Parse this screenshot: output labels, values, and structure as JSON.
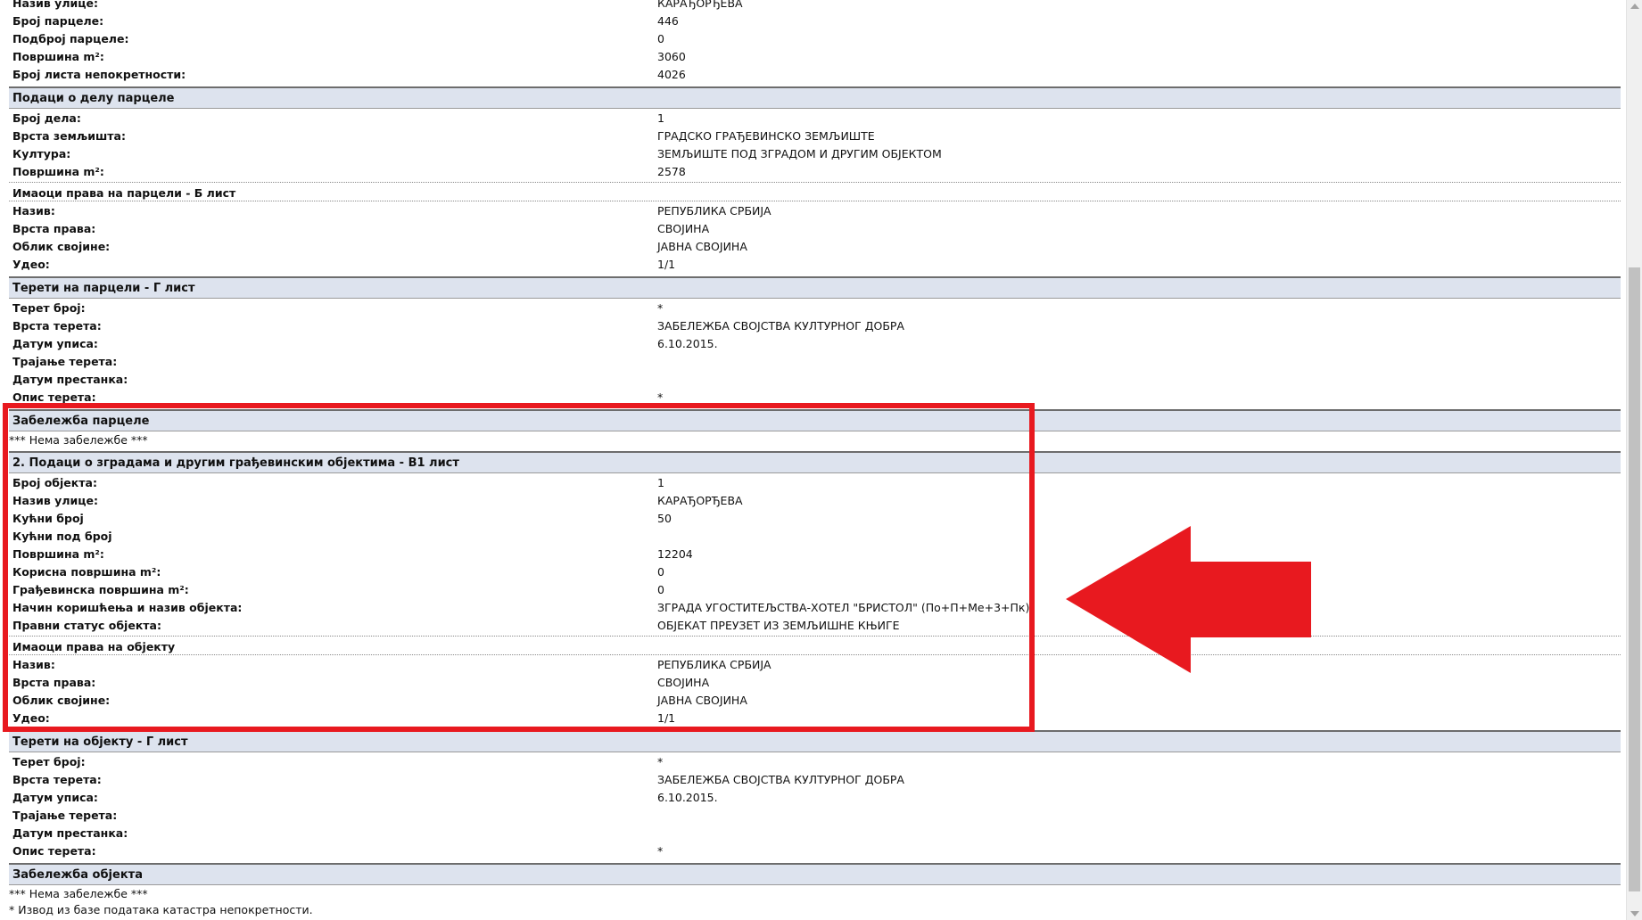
{
  "colors": {
    "section_bg": "#dde3ee",
    "highlight": "#e8191f"
  },
  "parcel_basic": [
    {
      "label": "Назив улице:",
      "value": "КАРАЂОРЂЕВА"
    },
    {
      "label": "Број парцеле:",
      "value": "446"
    },
    {
      "label": "Подброј парцеле:",
      "value": "0"
    },
    {
      "label": "Површина m²:",
      "value": "3060"
    },
    {
      "label": "Број листа непокретности:",
      "value": "4026"
    }
  ],
  "part_section": {
    "title": "Подаци о делу парцеле",
    "rows": [
      {
        "label": "Број дела:",
        "value": "1"
      },
      {
        "label": "Врста земљишта:",
        "value": "ГРАДСКО ГРАЂЕВИНСКО ЗЕМЉИШТЕ"
      },
      {
        "label": "Култура:",
        "value": "ЗЕМЉИШТЕ ПОД ЗГРАДОМ И ДРУГИМ ОБЈЕКТОМ"
      },
      {
        "label": "Површина m²:",
        "value": "2578"
      }
    ],
    "owners_title": "Имаоци права на парцели - Б лист",
    "owners": [
      {
        "label": "Назив:",
        "value": "РЕПУБЛИКА СРБИЈА"
      },
      {
        "label": "Врста права:",
        "value": "СВОЈИНА"
      },
      {
        "label": "Облик својине:",
        "value": "ЈАВНА СВОЈИНА"
      },
      {
        "label": "Удео:",
        "value": "1/1"
      }
    ]
  },
  "parcel_burdens": {
    "title": "Терети на парцели - Г лист",
    "rows": [
      {
        "label": "Терет број:",
        "value": "*"
      },
      {
        "label": "Врста терета:",
        "value": "ЗАБЕЛЕЖБА СВОЈСТВА КУЛТУРНОГ ДОБРА"
      },
      {
        "label": "Датум уписа:",
        "value": "6.10.2015."
      },
      {
        "label": "Трајање терета:",
        "value": ""
      },
      {
        "label": "Датум престанка:",
        "value": ""
      },
      {
        "label": "Опис терета:",
        "value": "*"
      }
    ]
  },
  "parcel_note": {
    "title": "Забележба парцеле",
    "text": "*** Нема забележбе ***"
  },
  "buildings": {
    "title": "2. Подаци о зградама и другим грађевинским објектима - В1 лист",
    "rows": [
      {
        "label": "Број објекта:",
        "value": "1"
      },
      {
        "label": "Назив улице:",
        "value": "КАРАЂОРЂЕВА"
      },
      {
        "label": "Кућни број",
        "value": "50"
      },
      {
        "label": "Кућни под број",
        "value": ""
      },
      {
        "label": "Површина m²:",
        "value": "12204"
      },
      {
        "label": "Корисна површина m²:",
        "value": "0"
      },
      {
        "label": "Грађевинска површина m²:",
        "value": "0"
      },
      {
        "label": "Начин коришћења и назив објекта:",
        "value": "ЗГРАДА УГОСТИТЕЉСТВА-ХОТЕЛ \"БРИСТОЛ\" (По+П+Ме+3+Пк)"
      },
      {
        "label": "Правни статус објекта:",
        "value": "ОБЈЕКАТ ПРЕУЗЕТ ИЗ ЗЕМЉИШНЕ КЊИГЕ"
      }
    ],
    "owners_title": "Имаоци права на објекту",
    "owners": [
      {
        "label": "Назив:",
        "value": "РЕПУБЛИКА СРБИЈА"
      },
      {
        "label": "Врста права:",
        "value": "СВОЈИНА"
      },
      {
        "label": "Облик својине:",
        "value": "ЈАВНА СВОЈИНА"
      },
      {
        "label": "Удео:",
        "value": "1/1"
      }
    ]
  },
  "object_burdens": {
    "title": "Терети на објекту - Г лист",
    "rows": [
      {
        "label": "Терет број:",
        "value": "*"
      },
      {
        "label": "Врста терета:",
        "value": "ЗАБЕЛЕЖБА СВОЈСТВА КУЛТУРНОГ ДОБРА"
      },
      {
        "label": "Датум уписа:",
        "value": "6.10.2015."
      },
      {
        "label": "Трајање терета:",
        "value": ""
      },
      {
        "label": "Датум престанка:",
        "value": ""
      },
      {
        "label": "Опис терета:",
        "value": "*"
      }
    ]
  },
  "object_note": {
    "title": "Забележба објекта",
    "text": "*** Нема забележбе ***"
  },
  "footer_note": "* Извод из базе података катастра непокретности."
}
